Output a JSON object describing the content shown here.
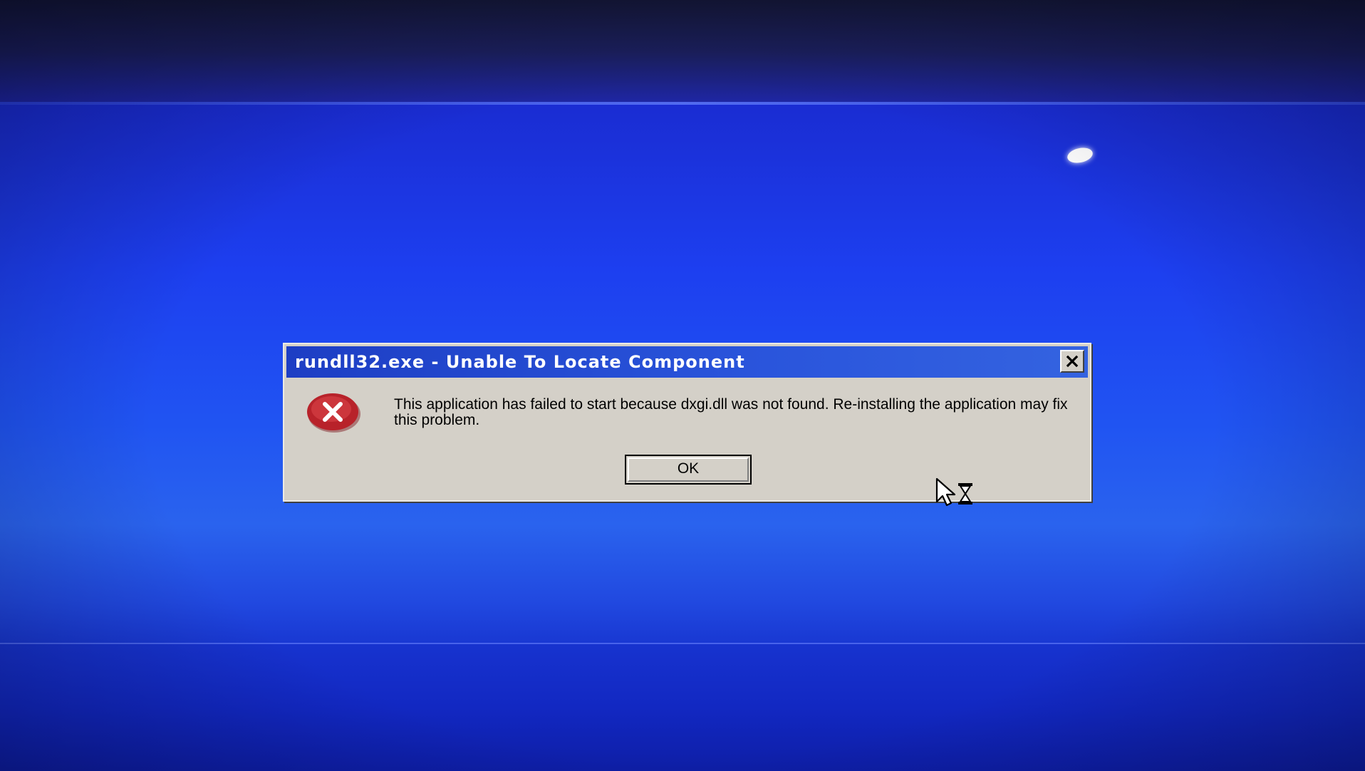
{
  "dialog": {
    "title": "rundll32.exe - Unable To Locate Component",
    "message": "This application has failed to start because dxgi.dll was not found. Re-installing the application may fix this problem.",
    "ok_label": "OK"
  },
  "icons": {
    "error": "error-icon",
    "close": "close-icon",
    "cursor": "busy-cursor-icon"
  },
  "colors": {
    "desktop": "#1d3ff0",
    "titlebar": "#1d3ec4",
    "dialog_face": "#d4d0c8",
    "error_red": "#c4262e"
  }
}
